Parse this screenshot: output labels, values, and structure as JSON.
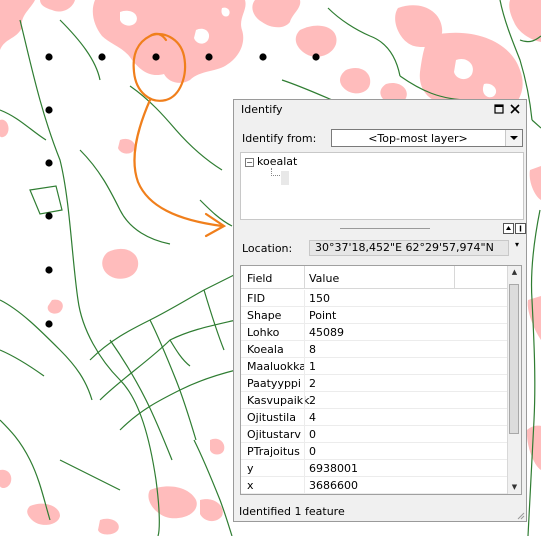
{
  "colors": {
    "forest": "#ffbcbc",
    "road": "#2f7d32",
    "arrow": "#f07f1c",
    "point": "#000000"
  },
  "window": {
    "title": "Identify",
    "float_icon": "restore-icon",
    "close_icon": "close-icon",
    "identify_from_label": "Identify from:",
    "identify_from_value": "<Top-most layer>",
    "tree_layer": "koealat",
    "location_label": "Location:",
    "location_value": "30°37'18,452\"E  62°29'57,974\"N",
    "grid": {
      "headers": [
        "Field",
        "Value"
      ],
      "rows": [
        {
          "field": "FID",
          "value": "150"
        },
        {
          "field": "Shape",
          "value": "Point"
        },
        {
          "field": "Lohko",
          "value": "45089"
        },
        {
          "field": "Koeala",
          "value": "8"
        },
        {
          "field": "Maaluokka",
          "value": "1"
        },
        {
          "field": "Paatyyppi",
          "value": "2"
        },
        {
          "field": "Kasvupaikk",
          "value": "2"
        },
        {
          "field": "Ojitustila",
          "value": "4"
        },
        {
          "field": "Ojitustarv",
          "value": "0"
        },
        {
          "field": "PTrajoitus",
          "value": "0"
        },
        {
          "field": "y",
          "value": "6938001"
        },
        {
          "field": "x",
          "value": "3686600"
        }
      ]
    },
    "status": "Identified 1 feature"
  }
}
